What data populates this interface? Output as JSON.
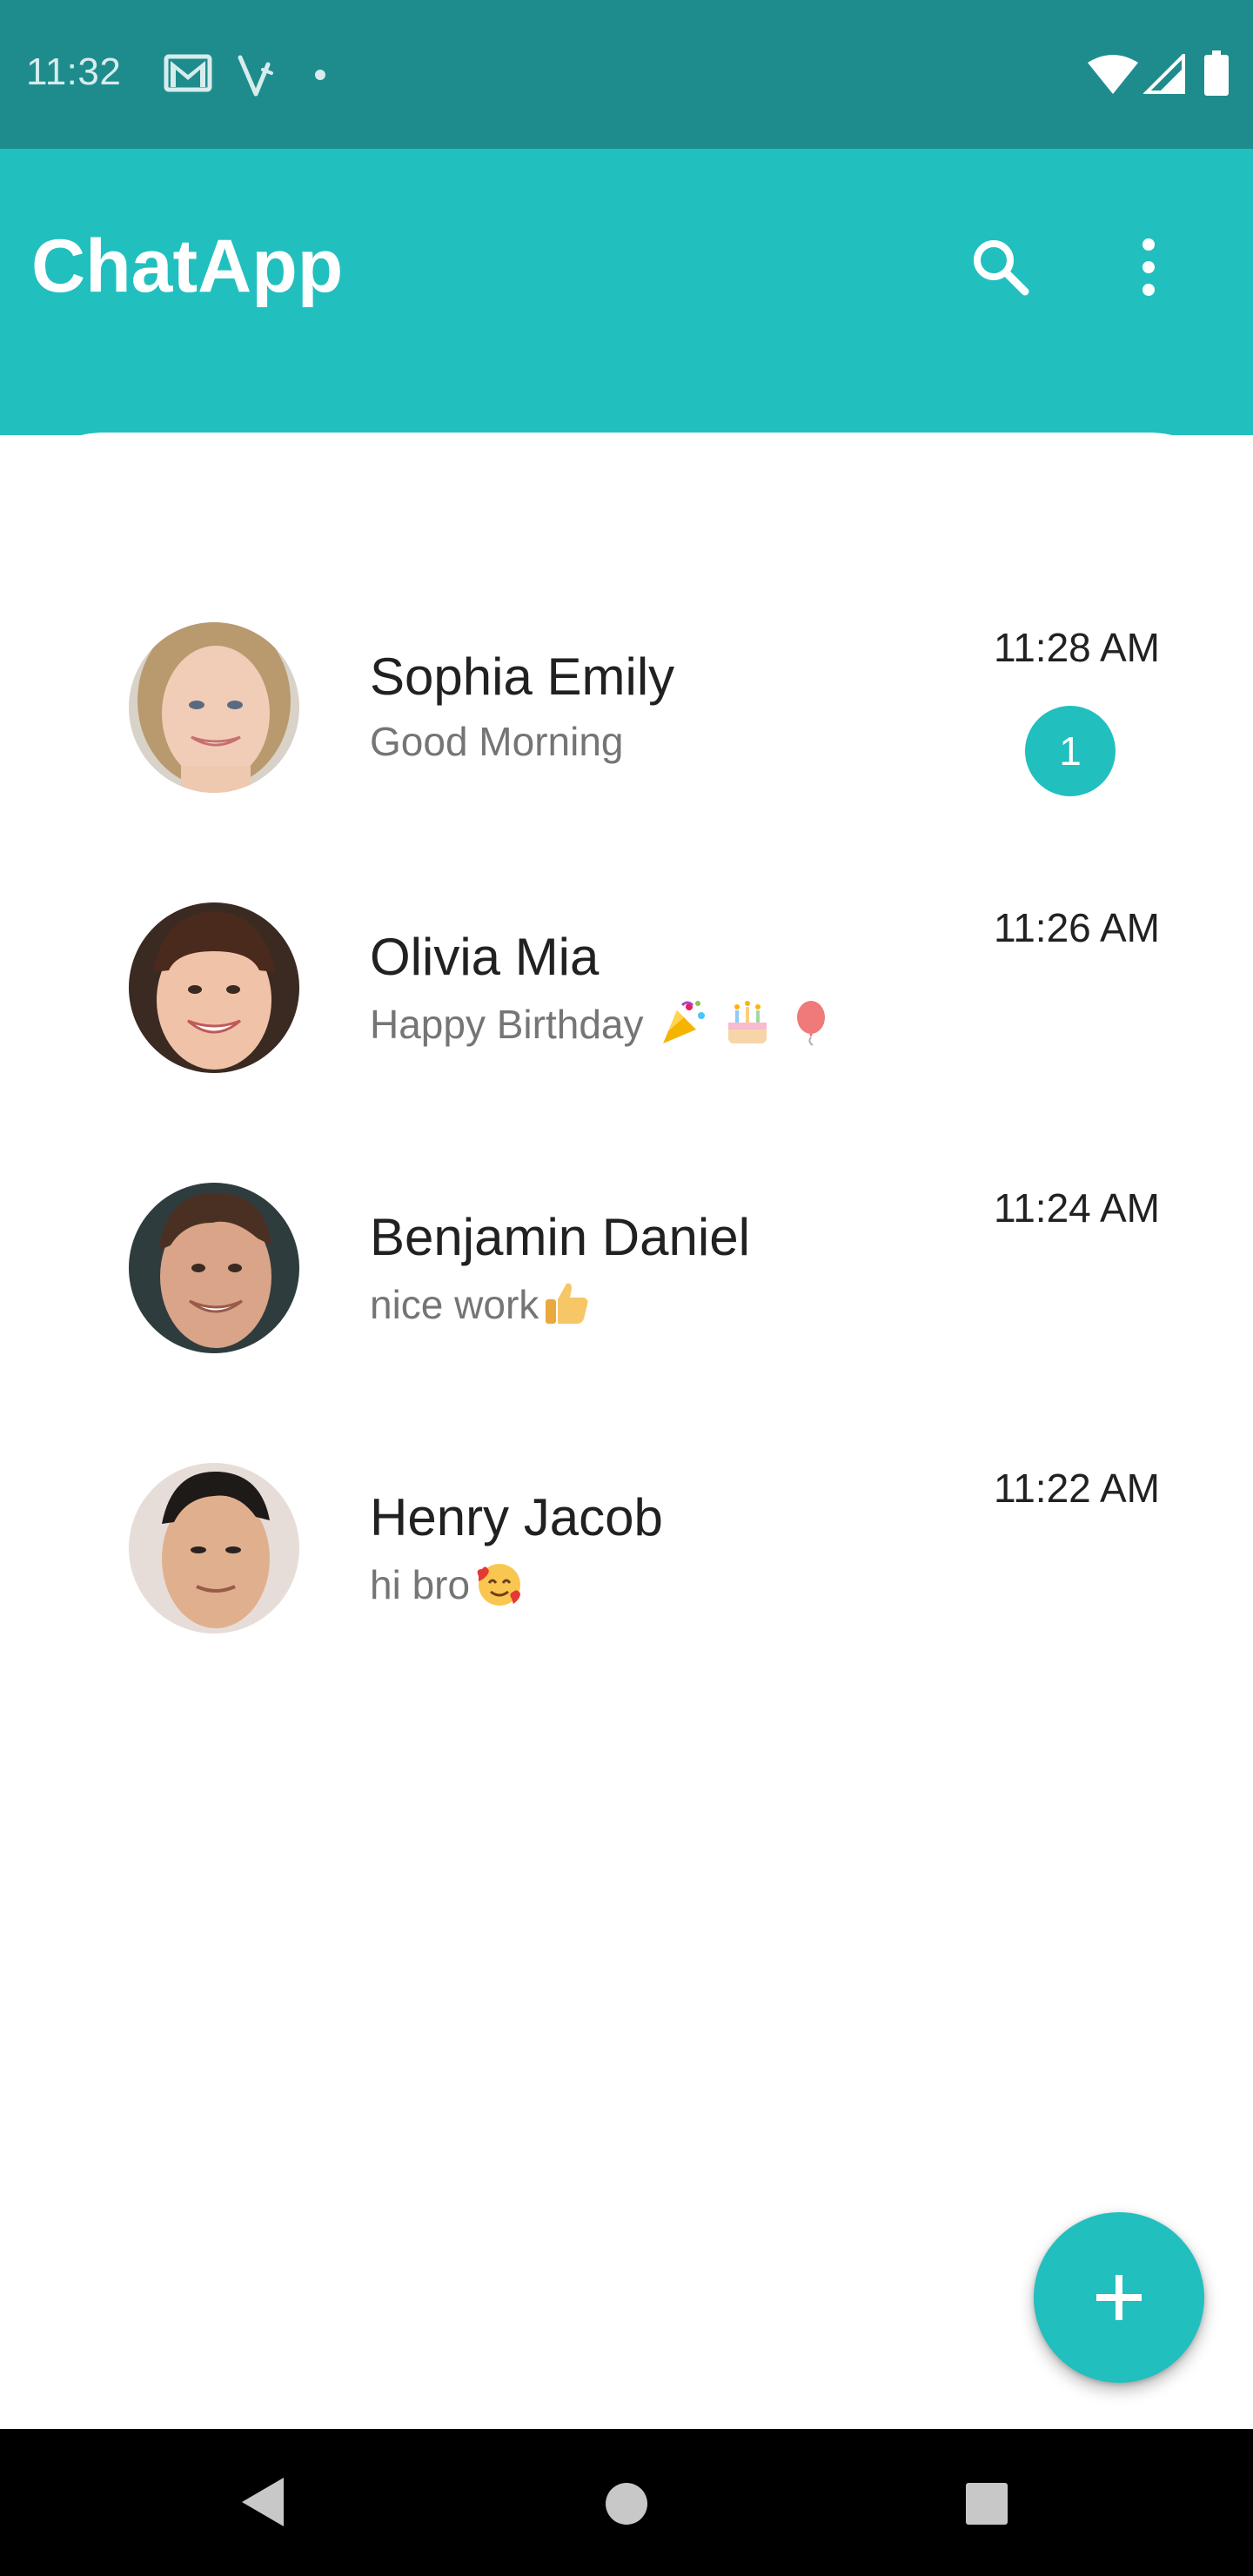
{
  "status_bar": {
    "time": "11:32",
    "icons": [
      "gmail-icon",
      "antenna-icon",
      "dot-icon",
      "wifi-icon",
      "signal-icon",
      "battery-icon"
    ]
  },
  "app_bar": {
    "title": "ChatApp",
    "actions": [
      "search-icon",
      "more-vert-icon"
    ]
  },
  "chats": [
    {
      "name": "Sophia Emily",
      "message": "Good Morning",
      "emoji": "",
      "time": "11:28 AM",
      "unread": "1"
    },
    {
      "name": "Olivia Mia",
      "message": "Happy Birthday ",
      "emoji": "party-cake-balloon",
      "time": "11:26 AM",
      "unread": ""
    },
    {
      "name": "Benjamin Daniel",
      "message": "nice work",
      "emoji": "thumbs-up",
      "time": "11:24 AM",
      "unread": ""
    },
    {
      "name": "Henry Jacob",
      "message": "hi bro",
      "emoji": "smiling-face-with-hearts",
      "time": "11:22 AM",
      "unread": ""
    }
  ],
  "fab": {
    "icon": "plus-icon"
  },
  "nav_bar": {
    "buttons": [
      "back-icon",
      "home-icon",
      "recents-icon"
    ]
  },
  "colors": {
    "status_bar": "#1e8c8c",
    "accent": "#22bfbf",
    "name_text": "#212121",
    "message_text": "#757575"
  }
}
